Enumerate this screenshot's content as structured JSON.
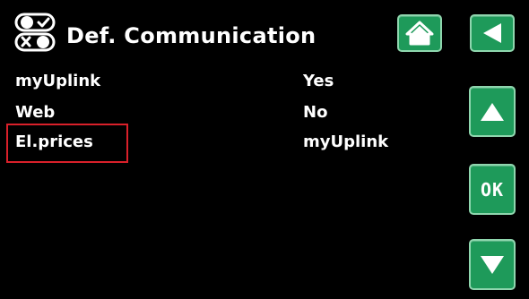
{
  "header": {
    "title": "Def. Communication",
    "title_icon": "toggle-switches-icon",
    "home_icon": "home-icon",
    "back_icon": "back-arrow-icon"
  },
  "rows": [
    {
      "label": "myUplink",
      "value": "Yes"
    },
    {
      "label": "Web",
      "value": "No"
    },
    {
      "label": "El.prices",
      "value": "myUplink"
    }
  ],
  "side_buttons": {
    "up_icon": "arrow-up-icon",
    "ok_label": "OK",
    "down_icon": "arrow-down-icon"
  },
  "colors": {
    "background": "#000000",
    "button": "#1e9a5a",
    "button_border": "#8fd6ae",
    "highlight": "#d9202a",
    "text": "#ffffff"
  }
}
